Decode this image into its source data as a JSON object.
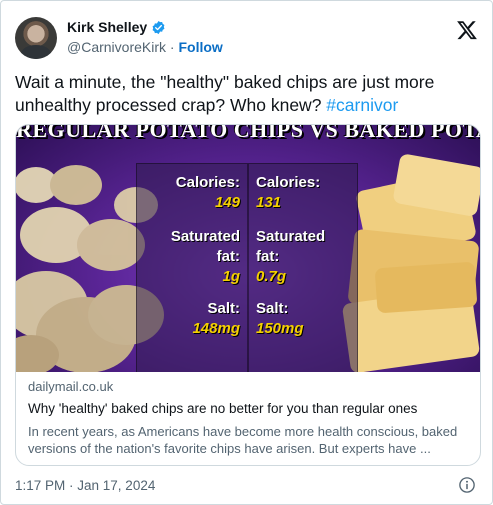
{
  "author": {
    "display_name": "Kirk Shelley",
    "handle": "@CarnivoreKirk",
    "separator": " · ",
    "follow_label": "Follow",
    "verified_color": "#1d9bf0",
    "avatar_icon": "avatar-photo"
  },
  "tweet": {
    "text": "Wait a minute, the \"healthy\" baked chips are just more unhealthy processed crap?  Who knew? ",
    "hashtag": "#carnivor"
  },
  "link_card": {
    "image": {
      "title": "REGULAR POTATO CHIPS VS BAKED POTATO CHIPS",
      "regular": {
        "calories_label": "Calories:",
        "calories_value": "149",
        "fat_label_1": "Saturated",
        "fat_label_2": "fat:",
        "fat_value": "1g",
        "salt_label": "Salt:",
        "salt_value": "148mg"
      },
      "baked": {
        "calories_label": "Calories:",
        "calories_value": "131",
        "fat_label_1": "Saturated",
        "fat_label_2": "fat:",
        "fat_value": "0.7g",
        "salt_label": "Salt:",
        "salt_value": "150mg"
      }
    },
    "domain": "dailymail.co.uk",
    "title": "Why 'healthy' baked chips are no better for you than regular ones",
    "description": "In recent years, as Americans have become more health conscious, baked versions of the nation's favorite chips have arisen. But experts have ..."
  },
  "footer": {
    "timestamp": "1:17 PM · Jan 17, 2024",
    "info_icon": "info-icon"
  },
  "colors": {
    "accent_link": "#0b6ec5",
    "hashtag": "#1d9bf0",
    "stat_value": "#f5d000",
    "image_bg": "#5a2596"
  }
}
